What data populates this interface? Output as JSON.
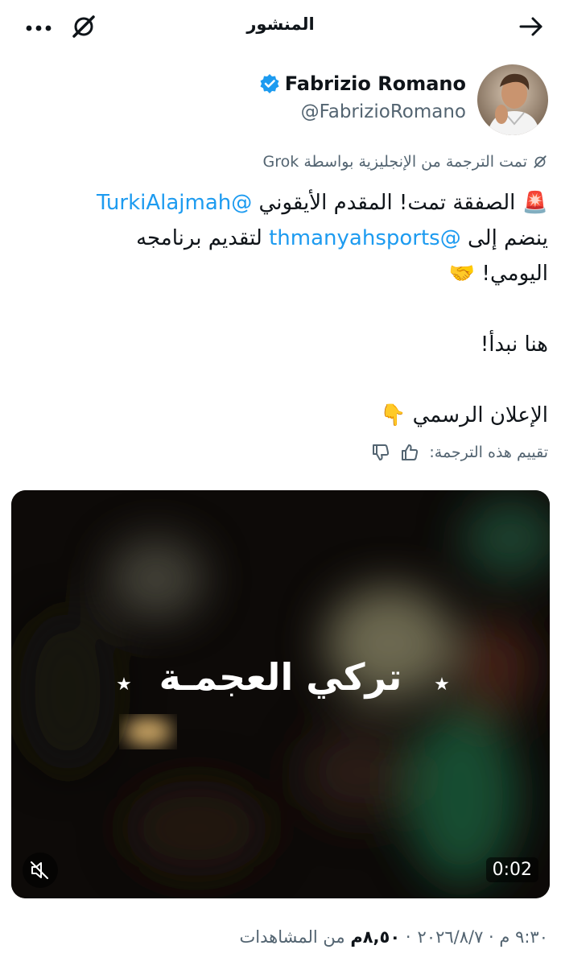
{
  "header": {
    "title": "المنشور",
    "back_icon": "arrow-right-icon",
    "grok_icon": "grok-icon",
    "more_icon": "more-horizontal-icon"
  },
  "author": {
    "name": "Fabrizio Romano",
    "handle": "@FabrizioRomano",
    "verified": true
  },
  "translation": {
    "note": "تمت الترجمة من الإنجليزية بواسطة Grok",
    "rate_label": "تقييم هذه الترجمة:"
  },
  "post": {
    "line1_emoji": "🚨",
    "line1_text": "الصفقة تمت! المقدم الأيقوني",
    "mention1": "@TurkiAlajmah",
    "line2_start": "ينضم إلى",
    "mention2": "@thmanyahsports",
    "line2_end": "لتقديم برنامجه",
    "line3": "اليومي!",
    "line3_emoji": "🤝",
    "paragraph2": "هنا نبدأ!",
    "paragraph3": "الإعلان الرسمي",
    "paragraph3_emoji": "👇"
  },
  "media": {
    "overlay_text": "تركي العجمـة",
    "duration": "0:02",
    "muted": true
  },
  "meta": {
    "timestamp": "٩:٣٠ م · ٢٠٢٦/٨/٧",
    "views_count": "٨,٥٠م",
    "views_label": "من المشاهدات"
  },
  "colors": {
    "accent": "#1d9bf0",
    "text": "#0f1419",
    "muted": "#536471"
  }
}
